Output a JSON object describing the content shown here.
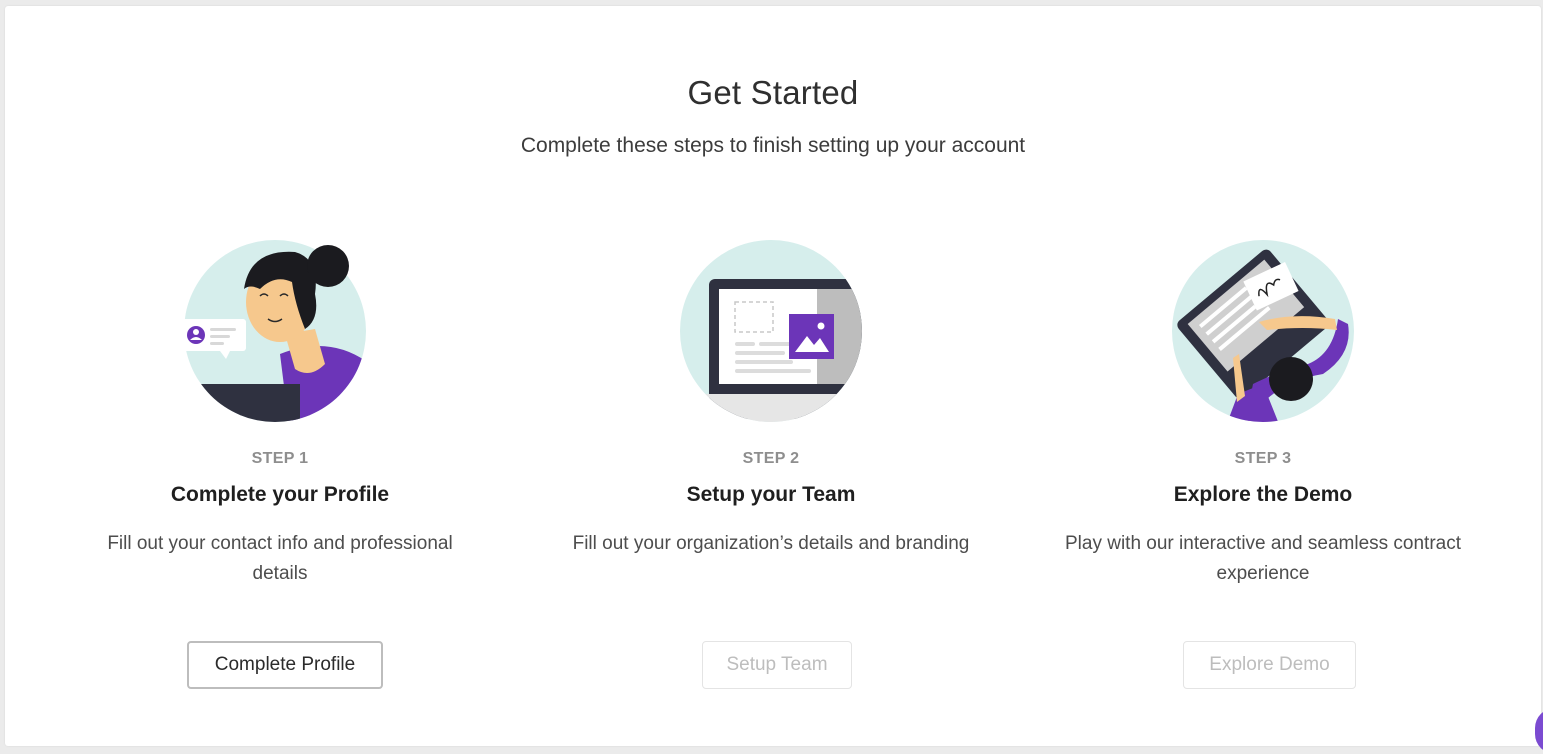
{
  "header": {
    "title": "Get Started",
    "subtitle": "Complete these steps to finish setting up your account"
  },
  "steps": [
    {
      "step_label": "STEP 1",
      "title": "Complete your Profile",
      "description": "Fill out your contact info and professional details",
      "button_label": "Complete Profile",
      "button_enabled": true
    },
    {
      "step_label": "STEP 2",
      "title": "Setup your Team",
      "description": "Fill out your organization’s details and branding",
      "button_label": "Setup Team",
      "button_enabled": false
    },
    {
      "step_label": "STEP 3",
      "title": "Explore the Demo",
      "description": "Play with our interactive and seamless contract experience",
      "button_label": "Explore Demo",
      "button_enabled": false
    }
  ],
  "icons": {
    "step1": "profile-illustration-icon",
    "step2": "team-branding-illustration-icon",
    "step3": "demo-contract-illustration-icon",
    "chat": "chat-launcher-icon"
  },
  "colors": {
    "accent_purple": "#6c35b8",
    "circle_bg": "#d6eeec",
    "disabled_text": "#bdbdbd"
  }
}
